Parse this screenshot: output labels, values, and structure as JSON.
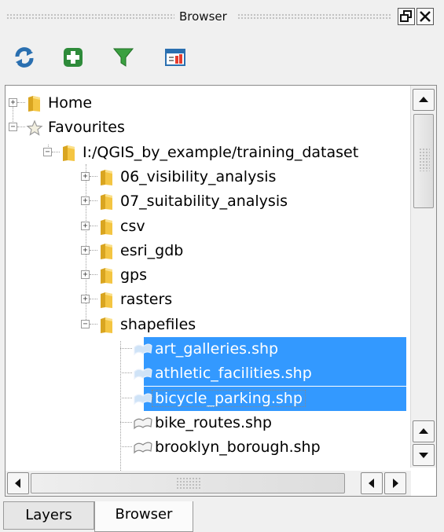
{
  "panel": {
    "title": "Browser"
  },
  "toolbar": {
    "icons": [
      "refresh-icon",
      "add-icon",
      "filter-icon",
      "properties-icon"
    ]
  },
  "tree": {
    "items": [
      {
        "label": "Home",
        "icon": "folder-icon",
        "expand": "+",
        "selected": false
      },
      {
        "label": "Favourites",
        "icon": "star-icon",
        "expand": "-",
        "selected": false
      },
      {
        "label": "I:/QGIS_by_example/training_dataset",
        "icon": "folder-icon",
        "expand": "-",
        "selected": false
      },
      {
        "label": "06_visibility_analysis",
        "icon": "folder-icon",
        "expand": "+",
        "selected": false
      },
      {
        "label": "07_suitability_analysis",
        "icon": "folder-icon",
        "expand": "+",
        "selected": false
      },
      {
        "label": "csv",
        "icon": "folder-icon",
        "expand": "+",
        "selected": false
      },
      {
        "label": "esri_gdb",
        "icon": "folder-icon",
        "expand": "+",
        "selected": false
      },
      {
        "label": "gps",
        "icon": "folder-icon",
        "expand": "+",
        "selected": false
      },
      {
        "label": "rasters",
        "icon": "folder-icon",
        "expand": "+",
        "selected": false
      },
      {
        "label": "shapefiles",
        "icon": "folder-icon",
        "expand": "-",
        "selected": false
      },
      {
        "label": "art_galleries.shp",
        "icon": "polygon-layer-icon",
        "expand": "",
        "selected": true
      },
      {
        "label": "athletic_facilities.shp",
        "icon": "polygon-layer-icon",
        "expand": "",
        "selected": true
      },
      {
        "label": "bicycle_parking.shp",
        "icon": "polygon-layer-icon",
        "expand": "",
        "selected": true
      },
      {
        "label": "bike_routes.shp",
        "icon": "polygon-layer-icon",
        "expand": "",
        "selected": false
      },
      {
        "label": "brooklyn_borough.shp",
        "icon": "polygon-layer-icon",
        "expand": "",
        "selected": false
      }
    ]
  },
  "tabs": [
    {
      "label": "Layers",
      "active": false
    },
    {
      "label": "Browser",
      "active": true
    }
  ],
  "colors": {
    "selection": "#3399ff",
    "background": "#f0f0f0"
  }
}
